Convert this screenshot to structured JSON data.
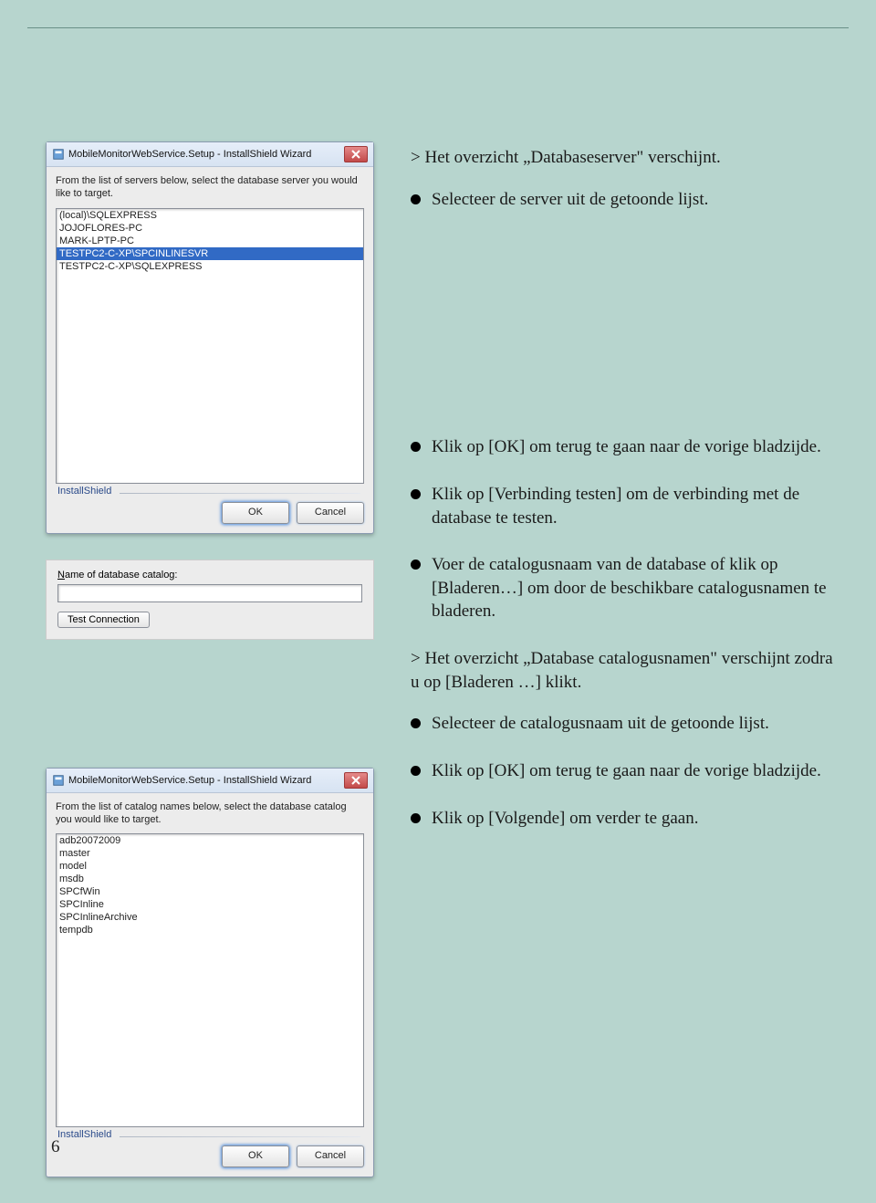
{
  "page_number": "6",
  "dialog1": {
    "title": "MobileMonitorWebService.Setup - InstallShield Wizard",
    "instruction": "From the list of servers below, select the database server you would like to target.",
    "items": [
      {
        "text": "(local)\\SQLEXPRESS",
        "selected": false
      },
      {
        "text": "JOJOFLORES-PC",
        "selected": false
      },
      {
        "text": "MARK-LPTP-PC",
        "selected": false
      },
      {
        "text": "TESTPC2-C-XP\\SPCINLINESVR",
        "selected": true
      },
      {
        "text": "TESTPC2-C-XP\\SQLEXPRESS",
        "selected": false
      }
    ],
    "brand": "InstallShield",
    "ok": "OK",
    "cancel": "Cancel"
  },
  "fieldsnip": {
    "label_pre": "N",
    "label_rest": "ame of database catalog:",
    "value": "",
    "test_btn": "Test Connection"
  },
  "dialog2": {
    "title": "MobileMonitorWebService.Setup - InstallShield Wizard",
    "instruction": "From the list of catalog names below, select the database catalog you would like to target.",
    "items": [
      {
        "text": "adb20072009",
        "selected": false
      },
      {
        "text": "master",
        "selected": false
      },
      {
        "text": "model",
        "selected": false
      },
      {
        "text": "msdb",
        "selected": false
      },
      {
        "text": "SPCfWin",
        "selected": false
      },
      {
        "text": "SPCInline",
        "selected": false
      },
      {
        "text": "SPCInlineArchive",
        "selected": false
      },
      {
        "text": "tempdb",
        "selected": false
      }
    ],
    "brand": "InstallShield",
    "ok": "OK",
    "cancel": "Cancel"
  },
  "text": {
    "t1": "Het overzicht „Databaseserver\" verschijnt.",
    "t2": "Selecteer de server uit de getoonde lijst.",
    "t3": "Klik op [OK] om terug te gaan naar de vorige bladzijde.",
    "t4": "Klik op [Verbinding testen] om de verbinding met de database te testen.",
    "t5": "Voer de catalogusnaam van de database of klik op [Bladeren…] om door de beschikbare catalogusnamen te bladeren.",
    "t6": "Het overzicht „Database catalogusnamen\" verschijnt zodra u op [Bladeren …] klikt.",
    "t7": "Selecteer de catalogusnaam uit de getoonde lijst.",
    "t8": "Klik op [OK] om terug te gaan naar de vorige bladzijde.",
    "t9": "Klik op [Volgende] om verder te gaan."
  }
}
